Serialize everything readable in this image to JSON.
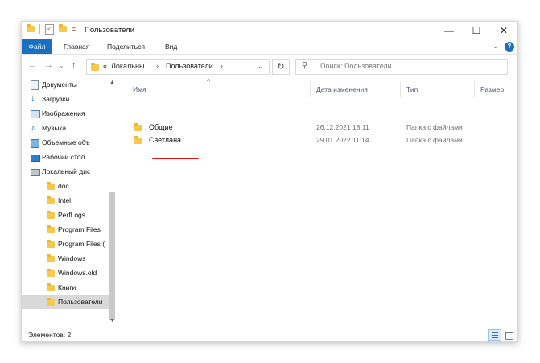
{
  "window": {
    "title": "Пользователи",
    "controls": {
      "minimize": "—",
      "maximize": "☐",
      "close": "✕"
    },
    "qat_dropdown": "="
  },
  "ribbon": {
    "tabs": [
      "Файл",
      "Главная",
      "Поделиться",
      "Вид"
    ],
    "expand": "⌄",
    "help": "?"
  },
  "address": {
    "back": "←",
    "forward": "→",
    "recent": "⌄",
    "up": "↑",
    "crumb_prefix": "«",
    "crumbs": [
      "Локальны...",
      "Пользователи"
    ],
    "sep": "›",
    "dropdown": "⌄",
    "refresh": "↻"
  },
  "search": {
    "placeholder": "Поиск: Пользователи",
    "icon": "search-icon"
  },
  "nav": {
    "items": [
      {
        "label": "Документы",
        "icon": "documents-icon"
      },
      {
        "label": "Загрузки",
        "icon": "downloads-icon"
      },
      {
        "label": "Изображения",
        "icon": "pictures-icon"
      },
      {
        "label": "Музыка",
        "icon": "music-icon"
      },
      {
        "label": "Объемные объ",
        "icon": "3d-objects-icon"
      },
      {
        "label": "Рабочий стол",
        "icon": "desktop-icon"
      },
      {
        "label": "Локальный дис",
        "icon": "drive-icon"
      },
      {
        "label": "doc",
        "icon": "folder-icon"
      },
      {
        "label": "Intel",
        "icon": "folder-icon"
      },
      {
        "label": "PerfLogs",
        "icon": "folder-icon"
      },
      {
        "label": "Program Files",
        "icon": "folder-icon"
      },
      {
        "label": "Program Files (",
        "icon": "folder-icon"
      },
      {
        "label": "Windows",
        "icon": "folder-icon"
      },
      {
        "label": "Windows.old",
        "icon": "folder-icon"
      },
      {
        "label": "Книги",
        "icon": "folder-icon"
      },
      {
        "label": "Пользователи",
        "icon": "folder-icon",
        "selected": true
      }
    ],
    "scroll_up": "▲",
    "scroll_down": "▼"
  },
  "columns": {
    "name": "Имя",
    "sort_indicator": "^",
    "date": "Дата изменения",
    "type": "Тип",
    "size": "Размер"
  },
  "files": [
    {
      "name": "Общие",
      "date": "26.12.2021 18:11",
      "type": "Папка с файлами"
    },
    {
      "name": "Светлана",
      "date": "29.01.2022 11:14",
      "type": "Папка с файлами"
    }
  ],
  "annotation": {
    "underline_color": "#e01414",
    "target": "Светлана"
  },
  "status": {
    "count": "Элементов: 2"
  },
  "colors": {
    "accent": "#1a6fc0",
    "folder": "#f6c94a",
    "selection": "#d9d9d9"
  }
}
